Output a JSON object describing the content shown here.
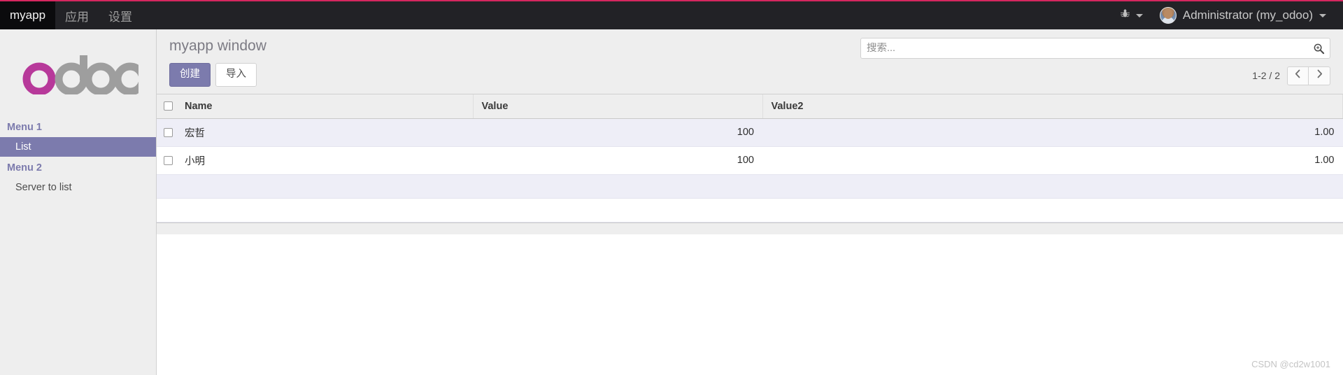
{
  "navbar": {
    "brand": "myapp",
    "items": [
      {
        "label": "应用"
      },
      {
        "label": "设置"
      }
    ],
    "bug_icon": "bug-icon",
    "user_name": "Administrator (my_odoo)"
  },
  "sidebar": {
    "logo_text": "odoo",
    "sections": [
      {
        "title": "Menu 1",
        "items": [
          {
            "label": "List",
            "active": true
          }
        ]
      },
      {
        "title": "Menu 2",
        "items": [
          {
            "label": "Server to list",
            "active": false
          }
        ]
      }
    ]
  },
  "control_panel": {
    "title": "myapp window",
    "create_label": "创建",
    "import_label": "导入",
    "search_placeholder": "搜索...",
    "search_value": "",
    "search_icon": "search-icon",
    "pager_text": "1-2 / 2",
    "prev_icon": "chevron-left-icon",
    "next_icon": "chevron-right-icon"
  },
  "table": {
    "columns": [
      {
        "label": "Name",
        "align": "left"
      },
      {
        "label": "Value",
        "align": "right"
      },
      {
        "label": "Value2",
        "align": "right"
      }
    ],
    "rows": [
      {
        "name": "宏哲",
        "value": "100",
        "value2": "1.00"
      },
      {
        "name": "小明",
        "value": "100",
        "value2": "1.00"
      }
    ]
  },
  "watermark": "CSDN @cd2w1001",
  "colors": {
    "accent": "#7c7bad",
    "navbar_bg": "#222226",
    "navbar_top_rule": "#d5275f",
    "sidebar_bg": "#eeeeee",
    "row_alt_bg": "#eeeef7",
    "logo_purple": "#b7399a"
  }
}
